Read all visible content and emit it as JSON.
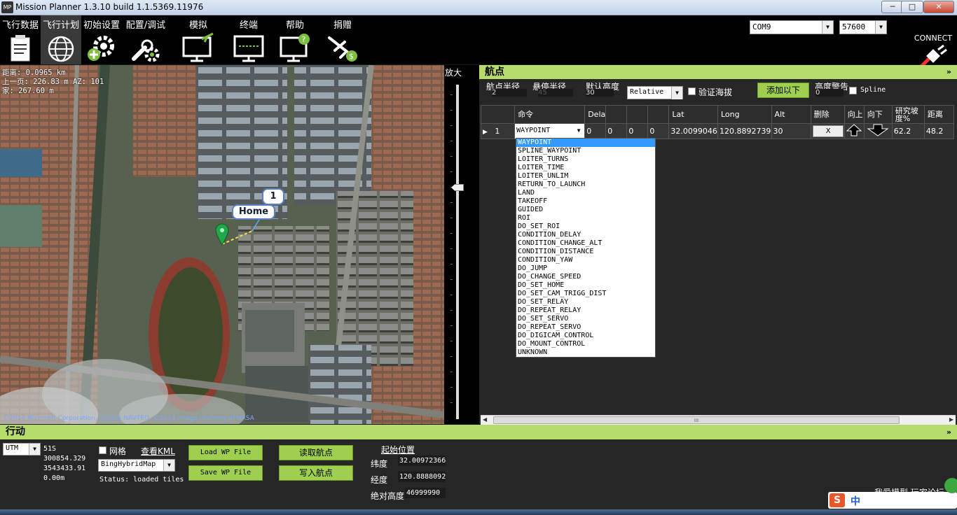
{
  "window": {
    "title": "Mission Planner 1.3.10 build 1.1.5369.11976",
    "app_icon": "MP",
    "min_label": "─",
    "max_label": "□",
    "close_label": "✕"
  },
  "menu": {
    "items": [
      {
        "label": "飞行数据",
        "icon": "clipboard-icon"
      },
      {
        "label": "飞行计划",
        "icon": "globe-icon"
      },
      {
        "label": "初始设置",
        "icon": "gear-plus-icon"
      },
      {
        "label": "配置/调试",
        "icon": "wrench-gear-icon"
      },
      {
        "label": "模拟",
        "icon": "monitor-plane-icon"
      },
      {
        "label": "终端",
        "icon": "terminal-monitor-icon"
      },
      {
        "label": "帮助",
        "icon": "help-monitor-icon"
      },
      {
        "label": "捐赠",
        "icon": "plane-dollar-icon"
      }
    ],
    "active_index": 1,
    "port": "COM9",
    "baud": "57600",
    "connect_label": "CONNECT"
  },
  "map": {
    "info_lines": [
      "距离: 0.0965 km",
      "上一页: 226.83 m AZ: 101",
      "家: 267.60 m"
    ],
    "home_label": "Home",
    "wp_marker_label": "1",
    "copyright": "©2014 Microsoft Corporation, ©2014 NAVTEQ, ©2014 Image courtesy of NASA",
    "zoom_label": "放大"
  },
  "waypoints": {
    "header": "航点",
    "collapse_icon": "»",
    "wp_radius_label": "航点半径",
    "wp_radius_value": "2",
    "loiter_radius_label": "悬停半径",
    "loiter_radius_value": "45",
    "default_alt_label": "默认高度",
    "default_alt_value": "30",
    "alt_frame": "Relative",
    "verify_height_label": "验证海拔",
    "add_below_label": "添加以下",
    "alt_warn_label": "高度警告",
    "alt_warn_value": "0",
    "spline_label": "Spline",
    "columns": [
      "",
      "命令",
      "Dela",
      "",
      "",
      "",
      "Lat",
      "Long",
      "Alt",
      "删除",
      "向上",
      "向下",
      "研究坡度%",
      "距离"
    ],
    "rows": [
      {
        "index": "1",
        "command": "WAYPOINT",
        "p1": "0",
        "p2": "0",
        "p3": "0",
        "p4": "0",
        "lat": "32.0099046",
        "lng": "120.8892739",
        "alt": "30",
        "delete": "X",
        "grad": "62.2",
        "dist": "48.2"
      }
    ],
    "command_options": [
      "WAYPOINT",
      "SPLINE_WAYPOINT",
      "LOITER_TURNS",
      "LOITER_TIME",
      "LOITER_UNLIM",
      "RETURN_TO_LAUNCH",
      "LAND",
      "TAKEOFF",
      "GUIDED",
      "ROI",
      "DO_SET_ROI",
      "CONDITION_DELAY",
      "CONDITION_CHANGE_ALT",
      "CONDITION_DISTANCE",
      "CONDITION_YAW",
      "DO_JUMP",
      "DO_CHANGE_SPEED",
      "DO_SET_HOME",
      "DO_SET_CAM_TRIGG_DIST",
      "DO_SET_RELAY",
      "DO_REPEAT_RELAY",
      "DO_SET_SERVO",
      "DO_REPEAT_SERVO",
      "DO_DIGICAM_CONTROL",
      "DO_MOUNT_CONTROL",
      "UNKNOWN"
    ],
    "selected_option": "WAYPOINT",
    "scroll_label": "III"
  },
  "action": {
    "header": "行动",
    "collapse_icon": "»",
    "coord_system": "UTM",
    "zone": "51S",
    "easting": "300854.329",
    "northing": "3543433.91",
    "altitude": "0.00m",
    "grid_label": "网格",
    "view_kml_label": "查看KML",
    "map_type": "BingHybridMap",
    "status": "Status: loaded tiles",
    "load_wp_label": "Load WP File",
    "save_wp_label": "Save WP File",
    "read_wp_label": "读取航点",
    "write_wp_label": "写入航点",
    "home_title": "起始位置",
    "lat_label": "纬度",
    "lat_value": "32.00972366",
    "lng_label": "经度",
    "lng_value": "120.8888092",
    "abs_alt_label": "绝对高度",
    "abs_alt_value": "46999990"
  },
  "overlay": {
    "watermark": "我爱模型 玩家论坛",
    "ime": "中"
  }
}
